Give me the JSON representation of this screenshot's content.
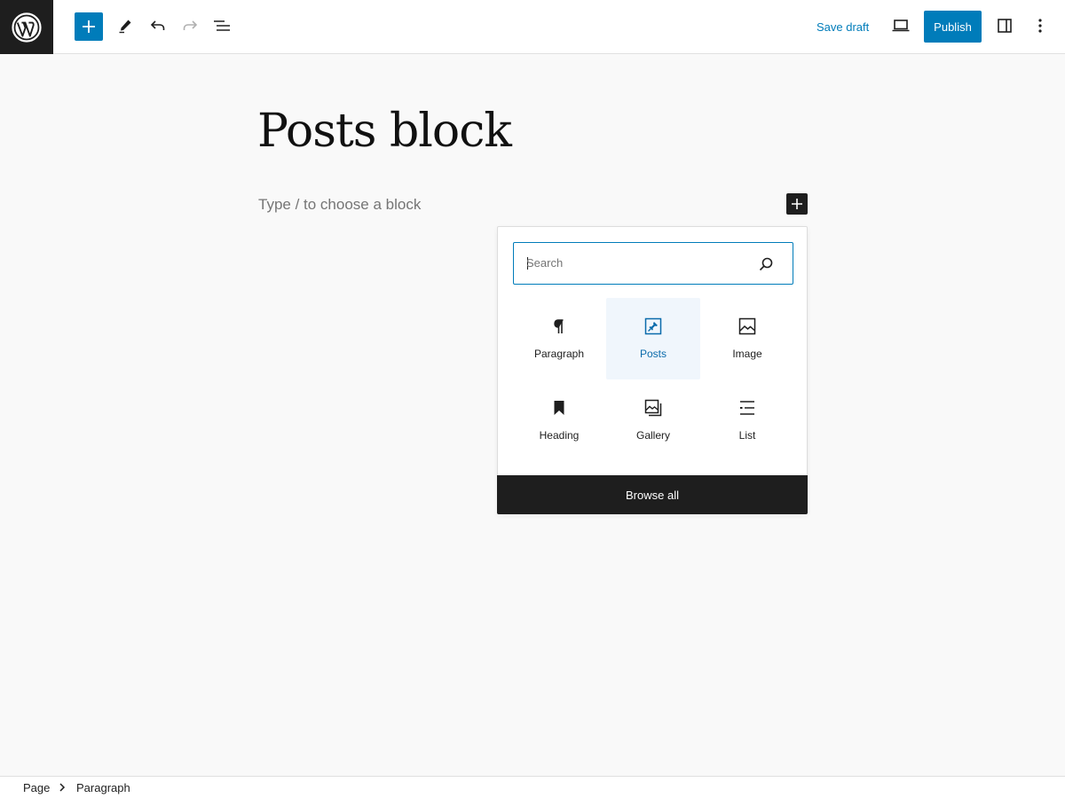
{
  "toolbar": {
    "save_draft_label": "Save draft",
    "publish_label": "Publish"
  },
  "editor": {
    "post_title": "Posts block",
    "block_placeholder": "Type / to choose a block"
  },
  "inserter": {
    "search_placeholder": "Search",
    "blocks": [
      {
        "label": "Paragraph",
        "icon": "paragraph-icon"
      },
      {
        "label": "Posts",
        "icon": "pin-icon",
        "selected": true
      },
      {
        "label": "Image",
        "icon": "image-icon"
      },
      {
        "label": "Heading",
        "icon": "bookmark-icon"
      },
      {
        "label": "Gallery",
        "icon": "gallery-icon"
      },
      {
        "label": "List",
        "icon": "list-icon"
      }
    ],
    "browse_all_label": "Browse all"
  },
  "breadcrumb": {
    "items": [
      "Page",
      "Paragraph"
    ]
  },
  "colors": {
    "accent": "#007cba",
    "dark": "#1e1e1e",
    "selected_bg": "#f0f6fc"
  }
}
